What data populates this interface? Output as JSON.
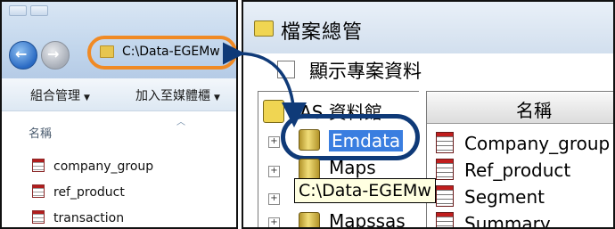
{
  "explorer": {
    "address_path": "C:\\Data-EGEMw",
    "toolbar": {
      "organize": "組合管理",
      "add_to_library": "加入至媒體櫃"
    },
    "column_header": "名稱",
    "files": [
      "company_group",
      "ref_product",
      "transaction"
    ]
  },
  "sas": {
    "title": "檔案總管",
    "checkbox_label": "顯示專案資料",
    "tree": {
      "root": "SAS 資料館",
      "libraries": [
        "Emdata",
        "Maps",
        "Mapssas"
      ]
    },
    "list_header": "名稱",
    "tables": [
      "Company_group",
      "Ref_product",
      "Segment",
      "Summary"
    ],
    "tooltip": "C:\\Data-EGEMw"
  },
  "colors": {
    "highlight_orange": "#f08a24",
    "highlight_navy": "#0f3a78",
    "selection_blue": "#3a7ee0"
  }
}
